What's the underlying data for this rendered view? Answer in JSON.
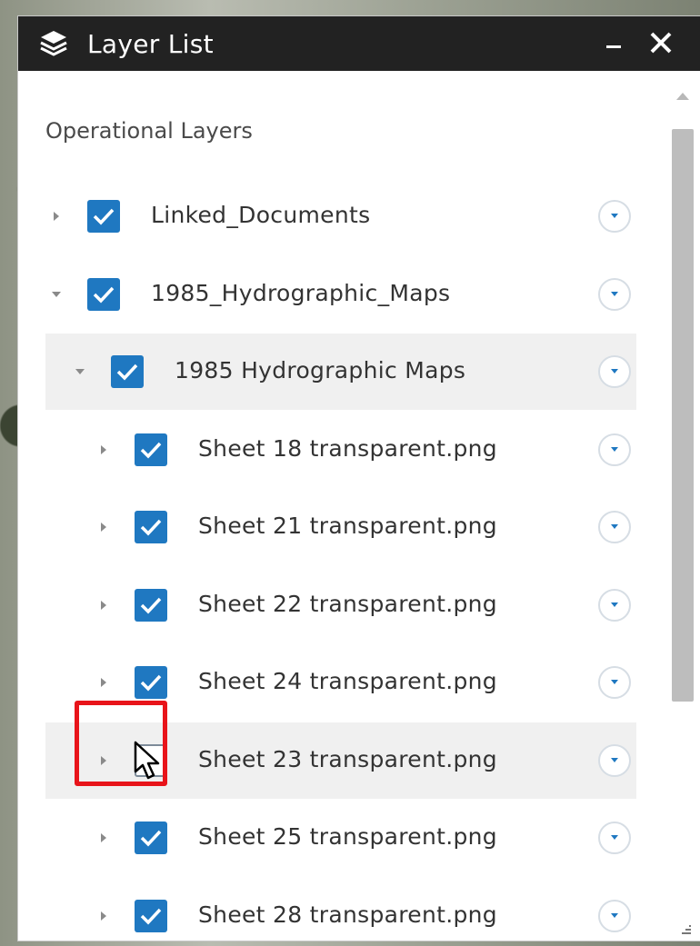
{
  "window": {
    "title": "Layer List",
    "icon": "layers-icon",
    "controls": [
      "minimize-icon",
      "close-icon"
    ]
  },
  "section_title": "Operational Layers",
  "layers": [
    {
      "label": "Linked_Documents",
      "checked": true,
      "expanded": false,
      "level": 0,
      "highlighted": false
    },
    {
      "label": "1985_Hydrographic_Maps",
      "checked": true,
      "expanded": true,
      "level": 0,
      "highlighted": false
    },
    {
      "label": "1985 Hydrographic Maps",
      "checked": true,
      "expanded": true,
      "level": 1,
      "highlighted": true
    },
    {
      "label": "Sheet 18 transparent.png",
      "checked": true,
      "expanded": false,
      "level": 2,
      "highlighted": false
    },
    {
      "label": "Sheet 21 transparent.png",
      "checked": true,
      "expanded": false,
      "level": 2,
      "highlighted": false
    },
    {
      "label": "Sheet 22 transparent.png",
      "checked": true,
      "expanded": false,
      "level": 2,
      "highlighted": false
    },
    {
      "label": "Sheet 24 transparent.png",
      "checked": true,
      "expanded": false,
      "level": 2,
      "highlighted": false
    },
    {
      "label": "Sheet 23 transparent.png",
      "checked": false,
      "expanded": false,
      "level": 2,
      "highlighted": true
    },
    {
      "label": "Sheet 25 transparent.png",
      "checked": true,
      "expanded": false,
      "level": 2,
      "highlighted": false
    },
    {
      "label": "Sheet 28 transparent.png",
      "checked": true,
      "expanded": false,
      "level": 2,
      "highlighted": false
    }
  ],
  "colors": {
    "titlebar": "#222222",
    "checkbox_checked": "#1f78c1",
    "highlight_row": "#f0f0f0",
    "callout_border": "#e8141a",
    "menu_arrow": "#1f78c1"
  }
}
